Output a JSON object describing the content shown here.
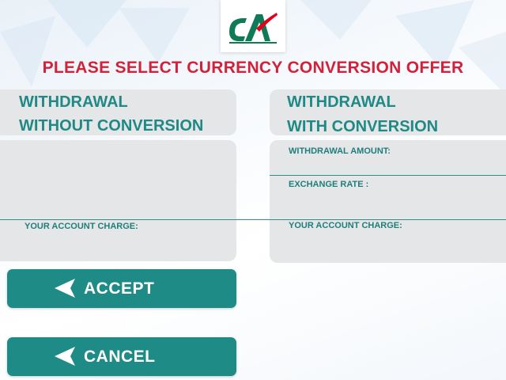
{
  "title": "PLEASE SELECT CURRENCY CONVERSION OFFER",
  "left_panel": {
    "heading_line1": "WITHDRAWAL",
    "heading_line2": "WITHOUT CONVERSION",
    "account_charge_label": "YOUR ACCOUNT CHARGE:"
  },
  "right_panel": {
    "heading_line1": "WITHDRAWAL",
    "heading_line2": "WITH CONVERSION",
    "withdrawal_amount_label": "WITHDRAWAL AMOUNT:",
    "exchange_rate_label": "EXCHANGE RATE :",
    "account_charge_label": "YOUR ACCOUNT CHARGE:"
  },
  "buttons": {
    "accept_label": "ACCEPT",
    "cancel_label": "CANCEL"
  },
  "colors": {
    "title_red": "#d0223a",
    "teal": "#1e8b87",
    "panel_gray": "#e5e6e8",
    "logo_green": "#0f7a57",
    "logo_red": "#e2001a"
  },
  "icons": {
    "logo": "credit-agricole-logo",
    "button_arrow": "left-arrow-icon"
  }
}
